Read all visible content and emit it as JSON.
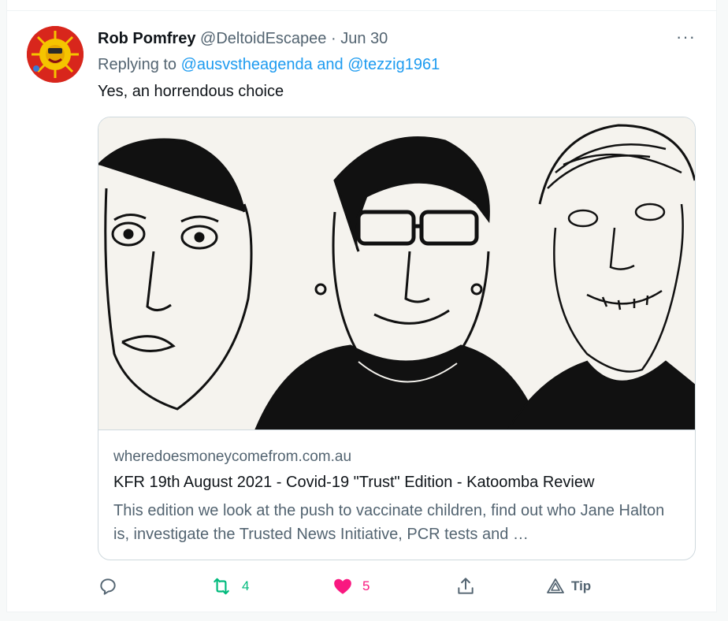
{
  "tweet": {
    "author_name": "Rob Pomfrey",
    "author_handle": "@DeltoidEscapee",
    "separator": "·",
    "date": "Jun 30",
    "replying_to_prefix": "Replying to",
    "replying_to_mentions": "@ausvstheagenda and @tezzig1961",
    "text": "Yes, an horrendous choice",
    "more_label": "···"
  },
  "card": {
    "domain": "wheredoesmoneycomefrom.com.au",
    "title": "KFR 19th August 2021 - Covid-19 \"Trust\" Edition - Katoomba Review",
    "description": "This edition we look at the push to vaccinate children, find out who Jane Halton is, investigate the Trusted News Initiative, PCR tests and …"
  },
  "actions": {
    "reply_icon": "reply-icon",
    "retweet_icon": "retweet-icon",
    "retweet_count": "4",
    "like_icon": "heart-filled-icon",
    "like_count": "5",
    "share_icon": "share-icon",
    "tip_icon": "tip-icon",
    "tip_label": "Tip"
  },
  "colors": {
    "accent": "#1d9bf0",
    "retweet": "#00ba7c",
    "like": "#f91880",
    "secondary_text": "#536471"
  }
}
